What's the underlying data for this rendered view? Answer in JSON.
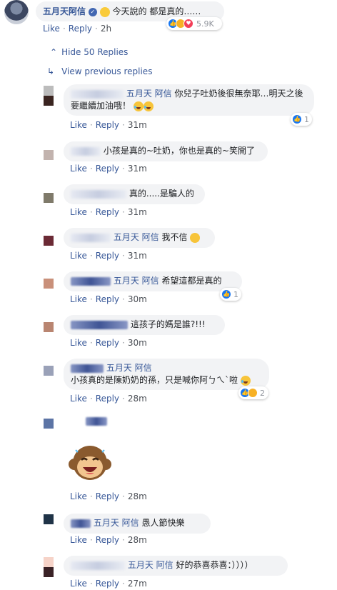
{
  "top": {
    "name": "五月天阿信",
    "text": "今天說的 都是真的……",
    "actions": {
      "like": "Like",
      "reply": "Reply",
      "time": "2h"
    },
    "reaction_count": "5.9K"
  },
  "hide_replies": "Hide 50 Replies",
  "view_previous": "View previous replies",
  "replies": [
    {
      "name": "五月天 阿信",
      "text": "你兒子吐奶後很無奈耶…明天之後要繼續加油哦！",
      "time": "31m",
      "react_count": "1"
    },
    {
      "name": "",
      "text": "小孩是真的~吐奶，你也是真的~笑開了",
      "time": "31m"
    },
    {
      "name": "",
      "text": "真的.....是騙人的",
      "time": "31m"
    },
    {
      "name": "五月天 阿信",
      "text": "我不信",
      "time": "31m"
    },
    {
      "name": "五月天 阿信",
      "text": "希望這都是真的",
      "time": "30m",
      "react_count": "1"
    },
    {
      "name": "",
      "text": "這孩子的媽是誰?!!!",
      "time": "30m"
    },
    {
      "name": "五月天 阿信",
      "text": "小孩真的是陳奶奶的孫，只是喊你阿ㄅㄟˋ啦",
      "time": "28m",
      "react_count": "2"
    },
    {
      "name": "",
      "text": "",
      "time": "28m"
    },
    {
      "name": "五月天 阿信",
      "text": "愚人節快樂",
      "time": "28m"
    },
    {
      "name": "五月天 阿信",
      "text": "好的恭喜恭喜：））））",
      "time": "27m"
    }
  ],
  "labels": {
    "like": "Like",
    "reply": "Reply",
    "dot": "·"
  },
  "colors": {
    "link": "#385898",
    "bubble": "#f2f3f5",
    "like": "#1877f2",
    "haha": "#f7b125",
    "love": "#f33e58"
  }
}
